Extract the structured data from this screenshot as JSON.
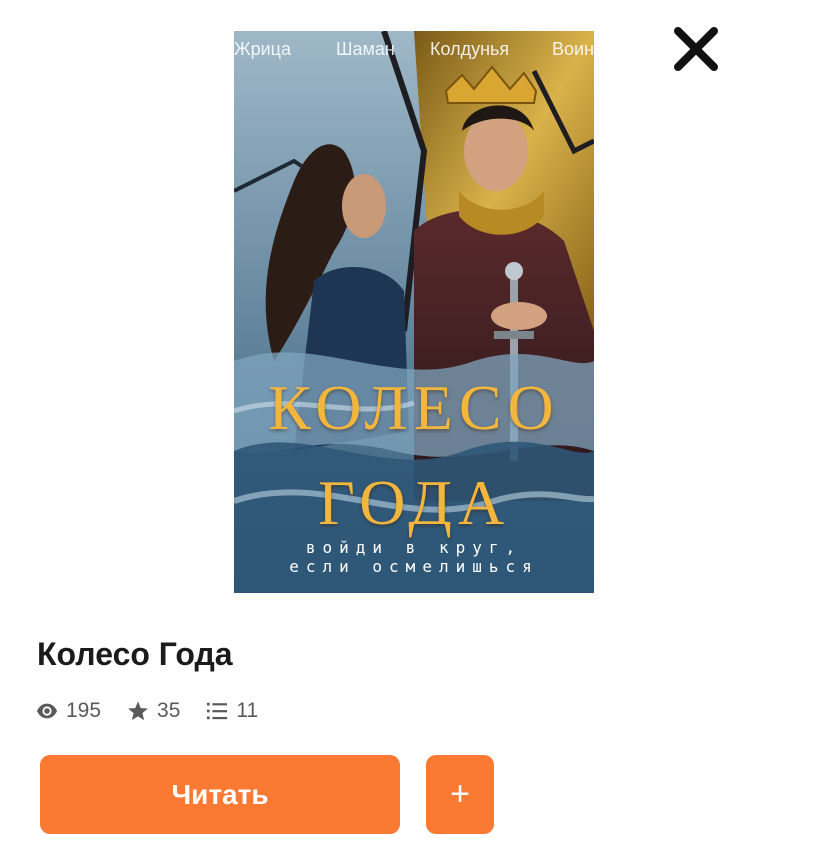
{
  "close": {
    "icon": "close-icon"
  },
  "cover": {
    "tags": [
      "Жрица",
      "Шаман",
      "Колдунья",
      "Воин"
    ],
    "title_line1": "КОЛЕСО",
    "title_line2": "ГОДА",
    "tagline_line1": "войди в круг,",
    "tagline_line2": "если осмелишься"
  },
  "book": {
    "title": "Колесо Года",
    "stats": {
      "views": "195",
      "stars": "35",
      "chapters": "11"
    }
  },
  "actions": {
    "read_label": "Читать",
    "add_label": "+"
  },
  "colors": {
    "accent": "#fa7a33",
    "title_gold": "#f2b63e",
    "text": "#1b1b1b",
    "muted": "#5a5a5a"
  }
}
